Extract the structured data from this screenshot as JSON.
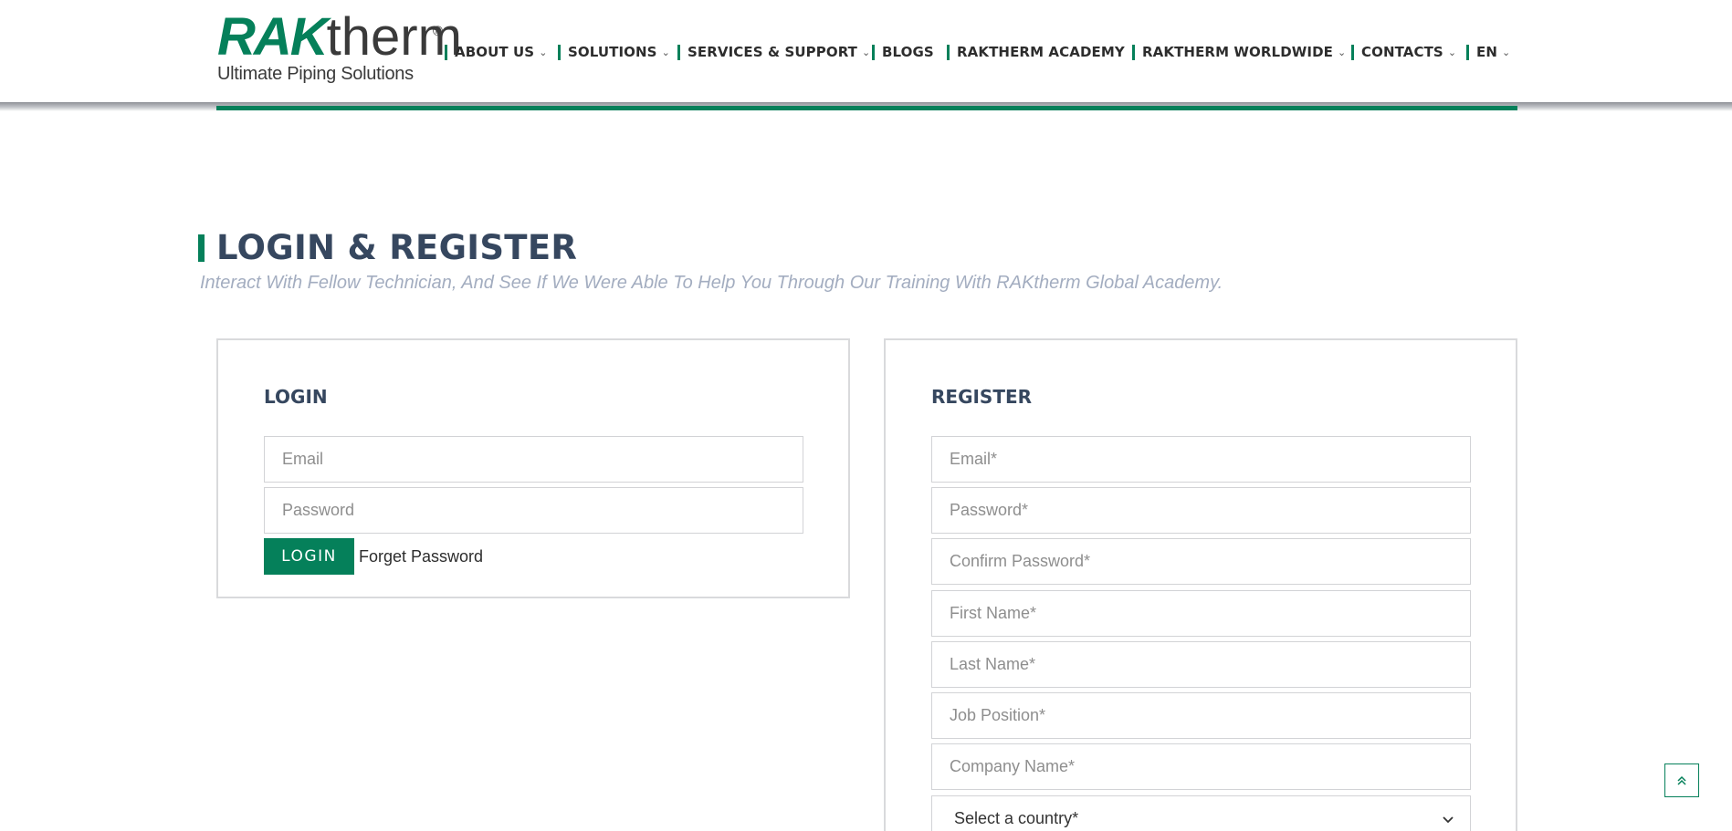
{
  "header": {
    "logo": {
      "brand_rak": "RAK",
      "brand_therm": "therm",
      "registered": "®",
      "tagline": "Ultimate Piping Solutions"
    },
    "nav": [
      {
        "label": "ABOUT US",
        "has_dropdown": true
      },
      {
        "label": "SOLUTIONS",
        "has_dropdown": true
      },
      {
        "label": "SERVICES & SUPPORT",
        "has_dropdown": true
      },
      {
        "label": "BLOGS",
        "has_dropdown": false
      },
      {
        "label": "RAKTHERM ACADEMY",
        "has_dropdown": false
      },
      {
        "label": "RAKTHERM WORLDWIDE",
        "has_dropdown": true
      },
      {
        "label": "CONTACTS",
        "has_dropdown": true
      },
      {
        "label": "EN",
        "has_dropdown": true
      }
    ],
    "dropdown_icon": "chevron-down-icon"
  },
  "page": {
    "title": "LOGIN & REGISTER",
    "subtitle": "Interact With Fellow Technician, And See If We Were Able To Help You Through Our Training With RAKtherm Global Academy."
  },
  "login": {
    "title": "LOGIN",
    "email_placeholder": "Email",
    "password_placeholder": "Password",
    "button_label": "LOGIN",
    "forget_link": "Forget Password"
  },
  "register": {
    "title": "REGISTER",
    "email_placeholder": "Email*",
    "password_placeholder": "Password*",
    "confirm_password_placeholder": "Confirm Password*",
    "first_name_placeholder": "First Name*",
    "last_name_placeholder": "Last Name*",
    "job_position_placeholder": "Job Position*",
    "company_name_placeholder": "Company Name*",
    "country_select_value": "Select a country*"
  },
  "back_to_top_icon": "double-chevron-up-icon",
  "colors": {
    "accent_green": "#05805a",
    "heading_navy": "#36475f",
    "subtitle_gray": "#a3adc0"
  }
}
